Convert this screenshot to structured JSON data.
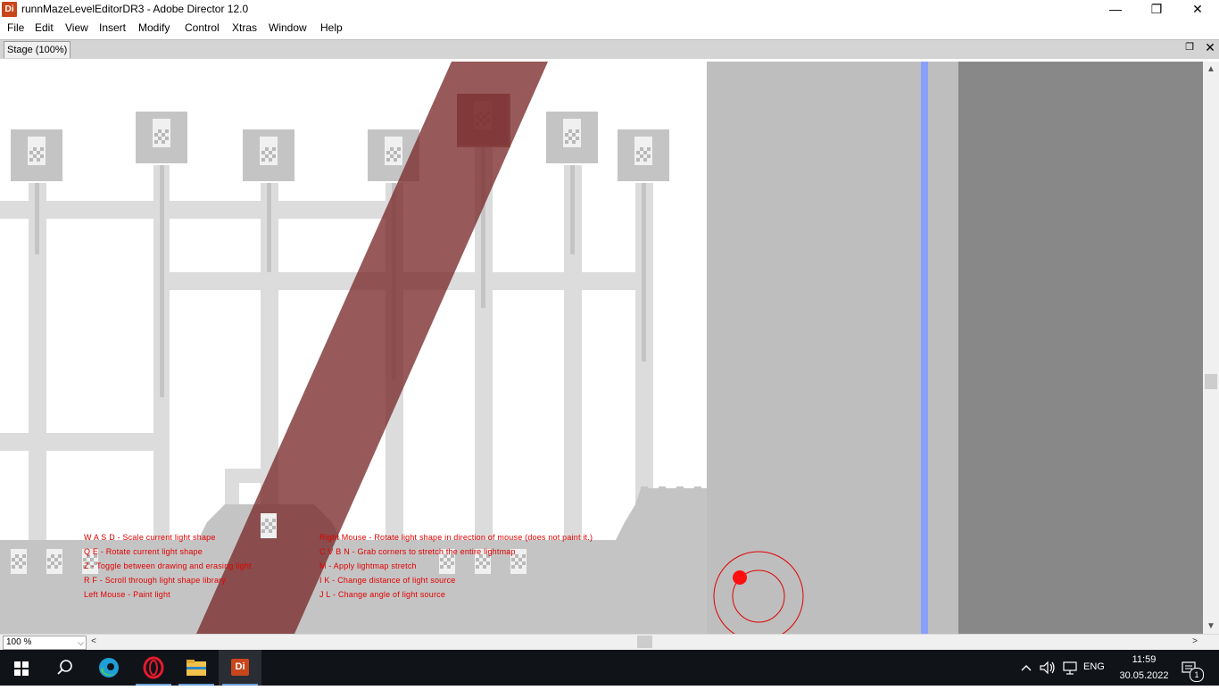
{
  "window": {
    "app_icon_text": "Di",
    "title": "runnMazeLevelEditorDR3 - Adobe Director 12.0",
    "minimize_glyph": "—",
    "maximize_glyph": "❐",
    "close_glyph": "✕"
  },
  "menu": {
    "items": [
      "File",
      "Edit",
      "View",
      "Insert",
      "Modify",
      "Control",
      "Xtras",
      "Window",
      "Help"
    ]
  },
  "stage_panel": {
    "tab_label": "Stage (100%)",
    "restore_glyph": "❐",
    "close_glyph": "✕"
  },
  "help_text": {
    "left": [
      "W A S D - Scale current light shape",
      "Q E - Rotate current light shape",
      "Z - Toggle between drawing and erasing light",
      "R F - Scroll through light shape library",
      "Left Mouse - Paint light"
    ],
    "right": [
      "Right Mouse - Rotate light shape in direction of mouse (does not paint it.)",
      "C V B N - Grab corners to stretch the entire lightmap",
      "M - Apply lightmap stretch",
      "I K - Change distance of light source",
      "J L - Change angle of light source"
    ]
  },
  "colors": {
    "light_shape": "#7a2a2a",
    "help_text": "#e10000",
    "blue_stripe": "#8aa0ff",
    "wall_gray": "#bebebe",
    "dark_gray": "#888888"
  },
  "bottom_bar": {
    "zoom_value": "100 %",
    "zoom_arrow": "⌵"
  },
  "scroll_glyphs": {
    "up": "▲",
    "down": "▼",
    "left": "<",
    "right": ">"
  },
  "taskbar": {
    "apps": [
      "start-icon",
      "search-icon",
      "edge-icon",
      "opera-icon",
      "file-explorer-icon",
      "director-icon"
    ],
    "director_label": "Di",
    "language": "ENG",
    "time": "11:59",
    "date": "30.05.2022",
    "notification_count": "1"
  }
}
